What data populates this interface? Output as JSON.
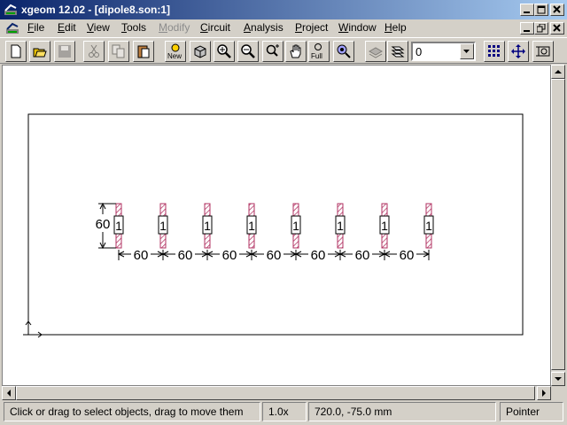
{
  "window": {
    "title": "xgeom 12.02 - [dipole8.son:1]"
  },
  "menu": [
    {
      "label": "File",
      "ul": "F",
      "rest": "ile"
    },
    {
      "label": "Edit",
      "ul": "E",
      "rest": "dit"
    },
    {
      "label": "View",
      "ul": "V",
      "rest": "iew"
    },
    {
      "label": "Tools",
      "ul": "T",
      "rest": "ools"
    },
    {
      "label": "Modify",
      "ul": "M",
      "rest": "odify",
      "disabled": true
    },
    {
      "label": "Circuit",
      "ul": "C",
      "rest": "ircuit"
    },
    {
      "label": "Analysis",
      "ul": "A",
      "rest": "nalysis"
    },
    {
      "label": "Project",
      "ul": "P",
      "rest": "roject"
    },
    {
      "label": "Window",
      "ul": "W",
      "rest": "indow"
    },
    {
      "label": "Help",
      "ul": "H",
      "rest": "elp"
    }
  ],
  "toolbar": {
    "level_value": "0",
    "new_label": "New",
    "full_label": "Full"
  },
  "drawing": {
    "port_label": "1",
    "dim_vertical": "60",
    "dim_horizontal": "60",
    "port_count": 8
  },
  "status": {
    "hint": "Click or drag to select objects, drag to move them",
    "zoom": "1.0x",
    "coords": "720.0, -75.0 mm",
    "mode": "Pointer"
  },
  "colors": {
    "titlebar_start": "#0a246a",
    "titlebar_end": "#a6caf0",
    "metal_hatch": "#b03060"
  }
}
